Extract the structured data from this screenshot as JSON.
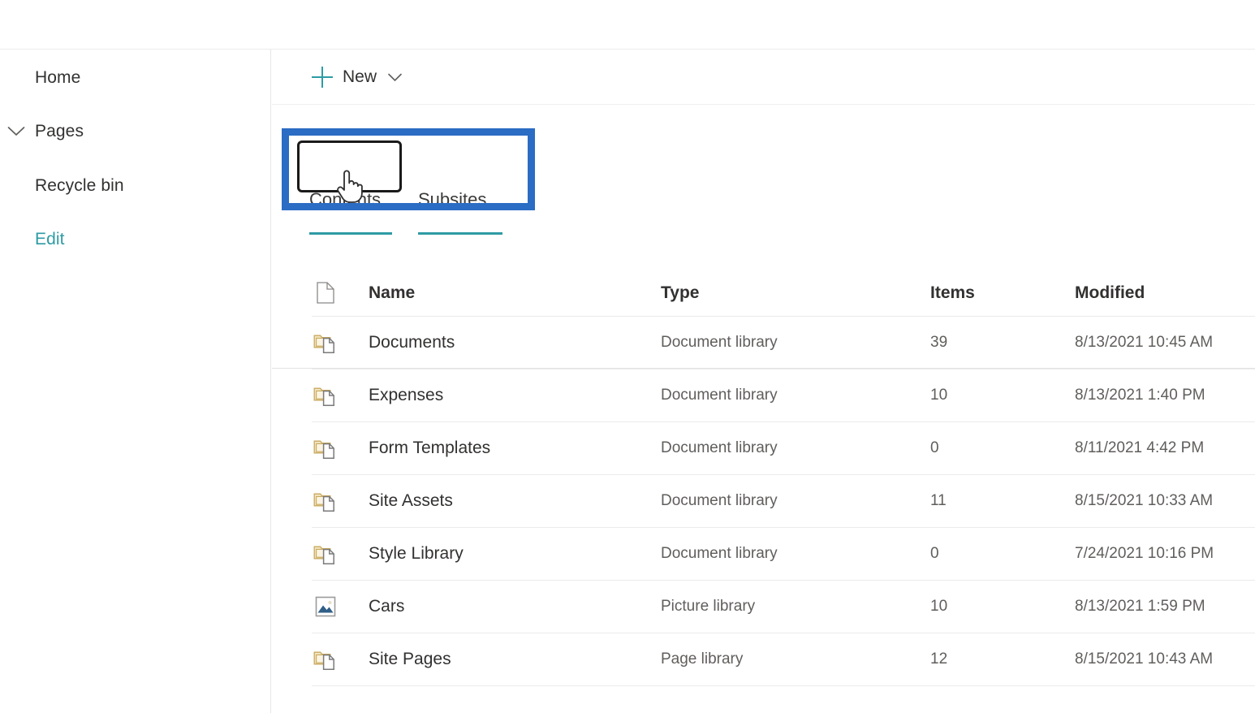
{
  "sidebar": {
    "items": [
      {
        "label": "Home",
        "icon": "",
        "accent": false,
        "has_chevron": false
      },
      {
        "label": "Pages",
        "icon": "chevron-down-icon",
        "accent": false,
        "has_chevron": true
      },
      {
        "label": "Recycle bin",
        "icon": "",
        "accent": false,
        "has_chevron": false
      },
      {
        "label": "Edit",
        "icon": "",
        "accent": true,
        "has_chevron": false
      }
    ]
  },
  "command_bar": {
    "new_label": "New",
    "plus_icon": "plus-icon",
    "chevron_icon": "chevron-down-icon"
  },
  "tabs": [
    {
      "label": "Contents",
      "selected": true,
      "focused": true
    },
    {
      "label": "Subsites",
      "selected": false,
      "focused": false
    }
  ],
  "table": {
    "columns": {
      "icon": "",
      "name": "Name",
      "type": "Type",
      "items": "Items",
      "modified": "Modified"
    },
    "rows": [
      {
        "icon": "document-library-icon",
        "name": "Documents",
        "type": "Document library",
        "items": "39",
        "modified": "8/13/2021 10:45 AM"
      },
      {
        "icon": "document-library-icon",
        "name": "Expenses",
        "type": "Document library",
        "items": "10",
        "modified": "8/13/2021 1:40 PM"
      },
      {
        "icon": "document-library-icon",
        "name": "Form Templates",
        "type": "Document library",
        "items": "0",
        "modified": "8/11/2021 4:42 PM"
      },
      {
        "icon": "document-library-icon",
        "name": "Site Assets",
        "type": "Document library",
        "items": "11",
        "modified": "8/15/2021 10:33 AM"
      },
      {
        "icon": "document-library-icon",
        "name": "Style Library",
        "type": "Document library",
        "items": "0",
        "modified": "7/24/2021 10:16 PM"
      },
      {
        "icon": "picture-library-icon",
        "name": "Cars",
        "type": "Picture library",
        "items": "10",
        "modified": "8/13/2021 1:59 PM"
      },
      {
        "icon": "document-library-icon",
        "name": "Site Pages",
        "type": "Page library",
        "items": "12",
        "modified": "8/15/2021 10:43 AM"
      }
    ]
  },
  "colors": {
    "accent_teal": "#2e9ba4",
    "annotation_blue": "#2b6cc4",
    "focus_black": "#1a1a1a",
    "text_primary": "#323130",
    "text_secondary": "#605e5c",
    "folder_gold": "#d9bd7e"
  },
  "cursor": {
    "type": "pointer-hand-cursor"
  }
}
